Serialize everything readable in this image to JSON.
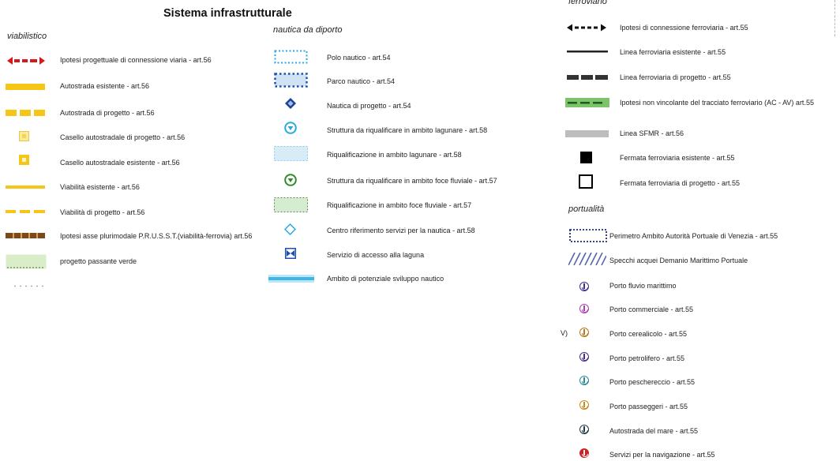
{
  "title": "Sistema infrastrutturale",
  "colors": {
    "red": "#d7191c",
    "yellow": "#f5c518",
    "light_yellow": "#f7e27a",
    "brown": "#7a4a1c",
    "light_green": "#d9edc8",
    "cyan": "#2aa9e0",
    "light_blue": "#cfe3f5",
    "dark_blue": "#1f3f9a",
    "green": "#2e8b2e",
    "grey": "#bdbdbd",
    "dark_grey": "#444444",
    "navy": "#1e2a78"
  },
  "viabilistico": {
    "heading": "viabilistico",
    "items": [
      {
        "label": "Ipotesi progettuale di connessione viaria - art.56",
        "icon": "red-dashed-double-arrow"
      },
      {
        "label": "Autostrada esistente - art.56",
        "icon": "yellow-thick-line"
      },
      {
        "label": "Autostrada di progetto - art.56",
        "icon": "yellow-thick-dashed-line"
      },
      {
        "label": "Casello autostradale di progetto - art.56",
        "icon": "light-yellow-square"
      },
      {
        "label": "Casello autostradale esistente - art.56",
        "icon": "yellow-square"
      },
      {
        "label": "Viabilità esistente - art.56",
        "icon": "yellow-thin-line"
      },
      {
        "label": "Viabilità di progetto - art.56",
        "icon": "yellow-thin-dashed-line"
      },
      {
        "label": "Ipotesi asse plurimodale P.R.U.S.S.T.(viabilità-ferrovia) art.56",
        "icon": "brown-dashed-line"
      },
      {
        "label": "progetto passante verde",
        "icon": "green-dotted-rectangle"
      }
    ]
  },
  "nautica": {
    "heading": "nautica da diporto",
    "items": [
      {
        "label": "Polo nautico - art.54",
        "icon": "cyan-dotted-rectangle"
      },
      {
        "label": "Parco nautico - art.54",
        "icon": "blue-dotted-filled-rectangle"
      },
      {
        "label": "Nautica di progetto - art.54",
        "icon": "blue-diamond"
      },
      {
        "label": "Struttura da riqualificare in ambito lagunare - art.58",
        "icon": "cyan-circle-triangle"
      },
      {
        "label": "Riqualificazione in ambito lagunare - art.58",
        "icon": "light-blue-rectangle"
      },
      {
        "label": "Struttura da riqualificare in ambito foce fluviale - art.57",
        "icon": "green-circle-triangle"
      },
      {
        "label": "Riqualificazione in ambito foce fluviale - art.57",
        "icon": "light-green-rectangle"
      },
      {
        "label": "Centro riferimento servizi per la nautica - art.58",
        "icon": "cyan-diamond-outline"
      },
      {
        "label": "Servizio di accesso alla laguna",
        "icon": "blue-bowtie-square"
      },
      {
        "label": "Ambito di potenziale sviluppo nautico",
        "icon": "cyan-band"
      }
    ]
  },
  "ferroviario": {
    "heading": "ferroviario",
    "items": [
      {
        "label": "Ipotesi di connessione ferroviaria - art.55",
        "icon": "black-dashed-double-arrow"
      },
      {
        "label": "Linea ferroviaria esistente - art.55",
        "icon": "black-line"
      },
      {
        "label": "Linea ferroviaria di progetto - art.55",
        "icon": "black-dashed-line"
      },
      {
        "label": "Ipotesi non vincolante del tracciato ferroviario (AC - AV) art.55",
        "icon": "green-dashed-band"
      },
      {
        "label": "Linea SFMR - art.56",
        "icon": "grey-band"
      },
      {
        "label": "Fermata ferroviaria esistente - art.55",
        "icon": "black-square"
      },
      {
        "label": "Fermata ferroviaria di progetto - art.55",
        "icon": "black-square-outline"
      }
    ]
  },
  "portualita": {
    "heading": "portualità",
    "items": [
      {
        "label": "Perimetro Ambito Autorità Portuale di Venezia - art.55",
        "icon": "navy-dotted-rectangle"
      },
      {
        "label": "Specchi acquei Demanio Marittimo Portuale",
        "icon": "blue-hatch"
      },
      {
        "label": "Porto fluvio marittimo",
        "icon": "anchor-purple",
        "color": "#3a2d8f"
      },
      {
        "label": "Porto commerciale - art.55",
        "icon": "anchor-magenta",
        "color": "#b03bb5"
      },
      {
        "label": "Porto cerealicolo - art.55",
        "icon": "anchor-orange",
        "color": "#b7771a",
        "prefix": "V)"
      },
      {
        "label": "Porto petrolifero - art.55",
        "icon": "anchor-violet",
        "color": "#4b2b86"
      },
      {
        "label": "Porto peschereccio - art.55",
        "icon": "anchor-teal",
        "color": "#2a8a9a"
      },
      {
        "label": "Porto passeggeri - art.55",
        "icon": "anchor-amber",
        "color": "#c98a1e"
      },
      {
        "label": "Autostrada del mare - art.55",
        "icon": "anchor-dark",
        "color": "#1f3a4a"
      },
      {
        "label": "Servizi per la navigazione - art.55",
        "icon": "anchor-red",
        "color": "#d32020"
      }
    ]
  }
}
